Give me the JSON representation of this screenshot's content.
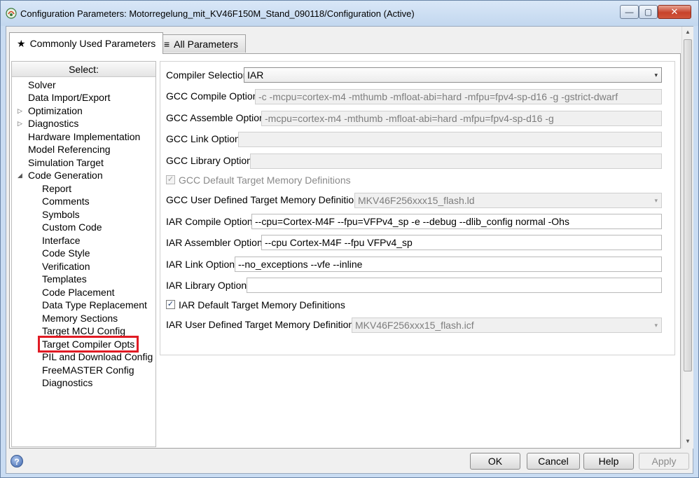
{
  "window": {
    "title": "Configuration Parameters: Motorregelung_mit_KV46F150M_Stand_090118/Configuration (Active)",
    "accent_color": "#c9dcf2"
  },
  "tabs": [
    {
      "label": "Commonly Used Parameters",
      "icon": "star-icon",
      "active": true
    },
    {
      "label": "All Parameters",
      "icon": "list-icon",
      "active": false
    }
  ],
  "tree": {
    "header": "Select:",
    "items": [
      {
        "label": "Solver",
        "level": 1,
        "expander": ""
      },
      {
        "label": "Data Import/Export",
        "level": 1,
        "expander": ""
      },
      {
        "label": "Optimization",
        "level": 1,
        "expander": "collapsed"
      },
      {
        "label": "Diagnostics",
        "level": 1,
        "expander": "collapsed"
      },
      {
        "label": "Hardware Implementation",
        "level": 1,
        "expander": ""
      },
      {
        "label": "Model Referencing",
        "level": 1,
        "expander": ""
      },
      {
        "label": "Simulation Target",
        "level": 1,
        "expander": ""
      },
      {
        "label": "Code Generation",
        "level": 1,
        "expander": "expanded"
      },
      {
        "label": "Report",
        "level": 2
      },
      {
        "label": "Comments",
        "level": 2
      },
      {
        "label": "Symbols",
        "level": 2
      },
      {
        "label": "Custom Code",
        "level": 2
      },
      {
        "label": "Interface",
        "level": 2
      },
      {
        "label": "Code Style",
        "level": 2
      },
      {
        "label": "Verification",
        "level": 2
      },
      {
        "label": "Templates",
        "level": 2
      },
      {
        "label": "Code Placement",
        "level": 2
      },
      {
        "label": "Data Type Replacement",
        "level": 2
      },
      {
        "label": "Memory Sections",
        "level": 2
      },
      {
        "label": "Target MCU Config",
        "level": 2
      },
      {
        "label": "Target Compiler Opts",
        "level": 2,
        "selected": true
      },
      {
        "label": "PIL and Download Config",
        "level": 2
      },
      {
        "label": "FreeMASTER Config",
        "level": 2
      },
      {
        "label": "Diagnostics",
        "level": 2
      }
    ]
  },
  "form": {
    "compiler_selection": {
      "label": "Compiler Selection",
      "value": "IAR"
    },
    "gcc_compile": {
      "label": "GCC Compile Options",
      "value": "-c -mcpu=cortex-m4 -mthumb -mfloat-abi=hard -mfpu=fpv4-sp-d16 -g -gstrict-dwarf"
    },
    "gcc_assemble": {
      "label": "GCC Assemble Options",
      "value": "-mcpu=cortex-m4 -mthumb -mfloat-abi=hard -mfpu=fpv4-sp-d16 -g"
    },
    "gcc_link": {
      "label": "GCC Link Options",
      "value": ""
    },
    "gcc_library": {
      "label": "GCC Library Options",
      "value": ""
    },
    "gcc_default_mem": {
      "label": "GCC Default Target Memory Definitions",
      "checked": true
    },
    "gcc_user_mem": {
      "label": "GCC User Defined Target Memory Definitions",
      "value": "MKV46F256xxx15_flash.ld"
    },
    "iar_compile": {
      "label": "IAR Compile Options",
      "value": "--cpu=Cortex-M4F --fpu=VFPv4_sp -e --debug --dlib_config normal -Ohs"
    },
    "iar_assembler": {
      "label": "IAR Assembler Options",
      "value": "--cpu Cortex-M4F --fpu VFPv4_sp"
    },
    "iar_link": {
      "label": "IAR Link Options",
      "value": "--no_exceptions --vfe --inline"
    },
    "iar_library": {
      "label": "IAR Library Options",
      "value": ""
    },
    "iar_default_mem": {
      "label": "IAR Default Target Memory Definitions",
      "checked": true
    },
    "iar_user_mem": {
      "label": "IAR User Defined Target Memory Definitions",
      "value": "MKV46F256xxx15_flash.icf"
    }
  },
  "buttons": {
    "ok": "OK",
    "cancel": "Cancel",
    "help": "Help",
    "apply": "Apply"
  },
  "glyphs": {
    "star": "★",
    "list": "≡",
    "check": "✓",
    "dropdown": "▾",
    "collapsed": "▷",
    "expanded": "◢",
    "scroll_up": "▲",
    "scroll_down": "▼",
    "help": "?",
    "minimize": "—",
    "maximize": "▢",
    "close": "✕"
  }
}
